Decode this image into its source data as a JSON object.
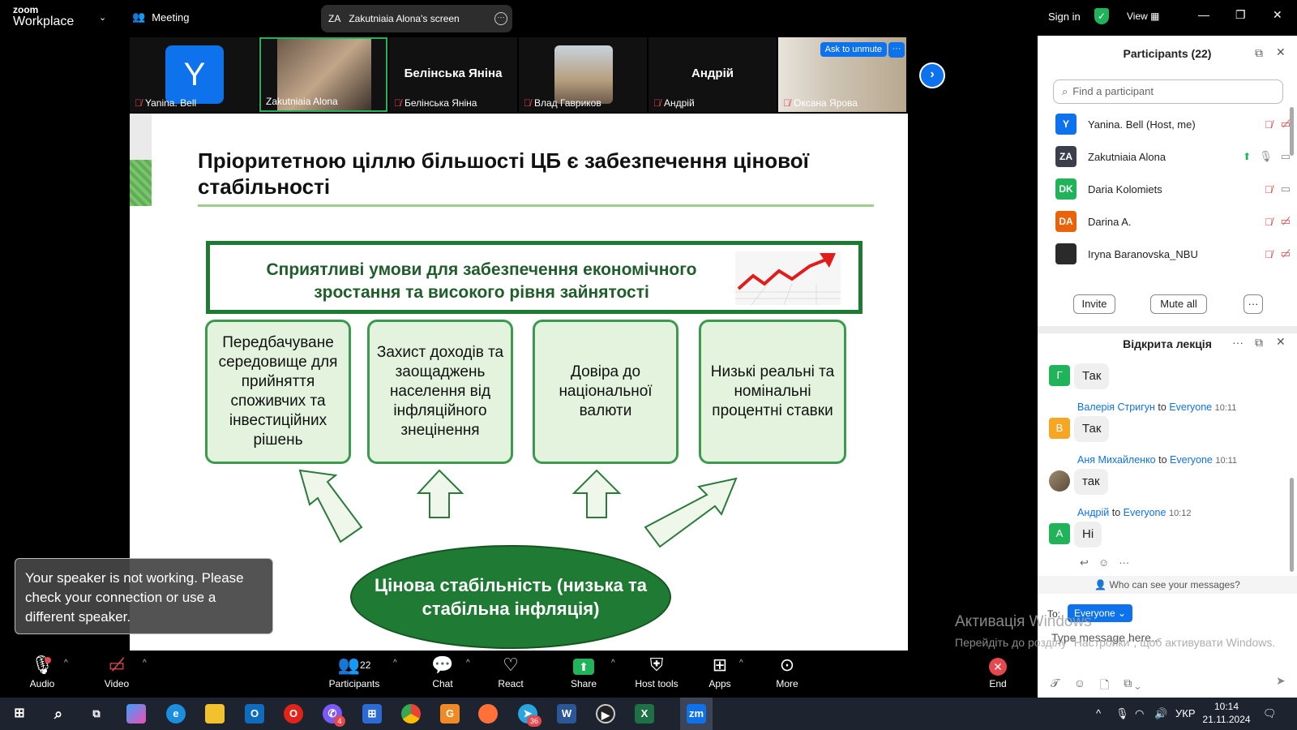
{
  "topbar": {
    "logo_top": "zoom",
    "logo_bottom": "Workplace",
    "meeting_label": "Meeting",
    "share_initials": "ZA",
    "share_label": "Zakutniaia Alona's screen",
    "sign_in": "Sign in",
    "view_label": "View"
  },
  "thumbnails": [
    {
      "name": "Yanina. Bell",
      "initial": "Y"
    },
    {
      "name": "Zakutniaia Alona"
    },
    {
      "name": "Белінська Яніна",
      "display": "Белінська Яніна"
    },
    {
      "name": "Влад Гавриков"
    },
    {
      "name": "Андрій",
      "display": "Андрій"
    },
    {
      "name": "Оксана Ярова",
      "ask_unmute": "Ask to unmute"
    }
  ],
  "slide": {
    "title": "Пріоритетною ціллю більшості ЦБ є забезпечення цінової стабільності",
    "top_box": "Сприятливі умови для забезпечення економічного зростання та високого рівня зайнятості",
    "boxes": [
      "Передбачуване середовище для прийняття споживчих та інвестиційних рішень",
      "Захист доходів та заощаджень населення від інфляційного знецінення",
      "Довіра до національної валюти",
      "Низькі реальні та номінальні процентні ставки"
    ],
    "oval": "Цінова стабільність (низька та стабільна інфляція)"
  },
  "toast": "Your speaker is not working. Please check your connection or use a different speaker.",
  "participants": {
    "title": "Participants (22)",
    "search_placeholder": "Find a participant",
    "list": [
      {
        "initials": "Y",
        "name": "Yanina. Bell (Host, me)",
        "color": "#0e72ed"
      },
      {
        "initials": "ZA",
        "name": "Zakutniaia Alona",
        "color": "#3a3f4b"
      },
      {
        "initials": "DK",
        "name": "Daria Kolomiets",
        "color": "#21b35a"
      },
      {
        "initials": "DA",
        "name": "Darina A.",
        "color": "#e8630a"
      },
      {
        "initials": "",
        "name": "Iryna Baranovska_NBU",
        "color": "#2a2a2a"
      }
    ],
    "invite": "Invite",
    "mute_all": "Mute all"
  },
  "chat": {
    "title": "Відкрита лекція",
    "messages": [
      {
        "avatar": "Г",
        "avatar_color": "#21b35a",
        "text": "Так"
      },
      {
        "sender": "Валерія Стригун",
        "to": "to",
        "recipient": "Everyone",
        "time": "10:11",
        "avatar": "В",
        "avatar_color": "#f5a623",
        "text": "Так"
      },
      {
        "sender": "Аня Михайленко",
        "to": "to",
        "recipient": "Everyone",
        "time": "10:11",
        "avatar": "",
        "avatar_color": "#8a7a6a",
        "text": "так"
      },
      {
        "sender": "Андрій",
        "to": "to",
        "recipient": "Everyone",
        "time": "10:12",
        "avatar": "А",
        "avatar_color": "#21b35a",
        "text": "Ні"
      }
    ],
    "who_can_see": "Who can see your messages?",
    "to_label": "To:",
    "recipient_button": "Everyone",
    "input_placeholder": "Type message here..."
  },
  "watermark": {
    "line1": "Активація Windows",
    "line2": "Перейдіть до розділу \"Настройки\", щоб активувати Windows."
  },
  "toolbar": {
    "audio": "Audio",
    "video": "Video",
    "participants": "Participants",
    "participants_count": "22",
    "chat": "Chat",
    "react": "React",
    "share": "Share",
    "host_tools": "Host tools",
    "apps": "Apps",
    "more": "More",
    "end": "End"
  },
  "taskbar": {
    "lang": "УКР",
    "time": "10:14",
    "date": "21.11.2024",
    "viber_badge": "4",
    "telegram_badge": "36"
  }
}
